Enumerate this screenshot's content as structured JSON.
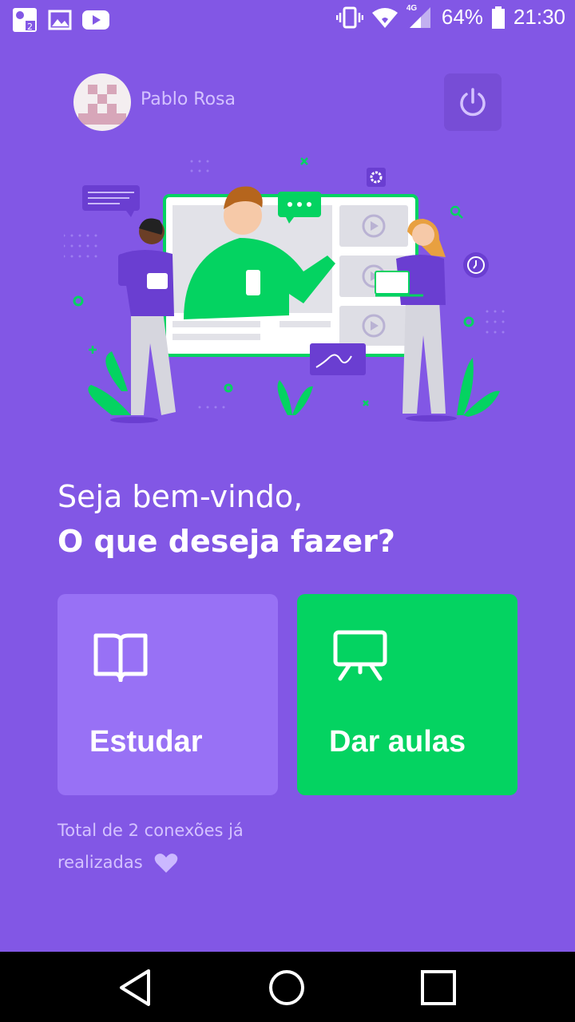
{
  "status_bar": {
    "battery": "64%",
    "time": "21:30",
    "network": "4G",
    "notification_icons": [
      "image-notification-icon",
      "gallery-icon",
      "youtube-icon"
    ],
    "system_icons": [
      "vibrate-icon",
      "wifi-icon",
      "signal-icon",
      "battery-icon"
    ]
  },
  "header": {
    "user_name": "Pablo Rosa",
    "logout_icon": "power-icon"
  },
  "welcome": {
    "line1": "Seja bem-vindo,",
    "line2": "O que deseja fazer?"
  },
  "actions": {
    "study": {
      "label": "Estudar",
      "icon": "book-icon",
      "color": "#9871f5"
    },
    "teach": {
      "label": "Dar aulas",
      "icon": "presentation-icon",
      "color": "#04d361"
    }
  },
  "connections": {
    "line1": "Total de 2 conexões já",
    "line2": "realizadas"
  },
  "colors": {
    "background": "#8257e5",
    "accent_green": "#04d361",
    "secondary_text": "#d4c2ff"
  },
  "nav_bar": {
    "buttons": [
      "back-icon",
      "home-icon",
      "recents-icon"
    ]
  }
}
